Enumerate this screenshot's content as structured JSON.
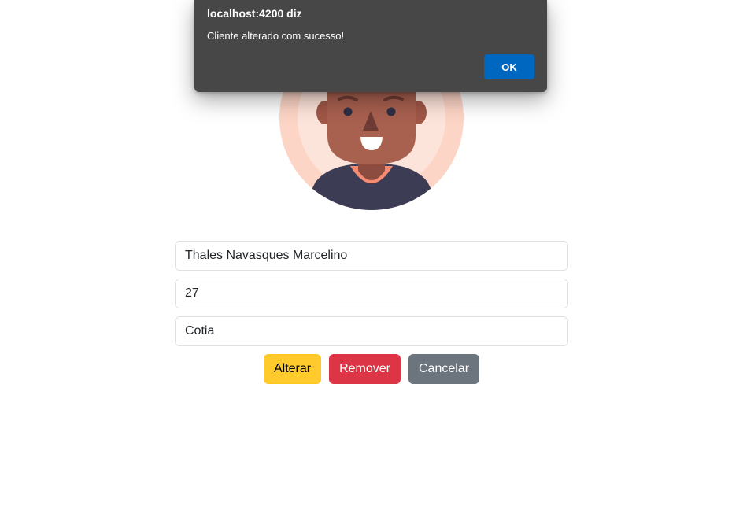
{
  "dialog": {
    "origin": "localhost:4200 diz",
    "message": "Cliente alterado com sucesso!",
    "ok_label": "OK",
    "ok_color": "#0067c0",
    "background": "#474747"
  },
  "avatar": {
    "icon": "person-avatar-illustration",
    "ring_outer_color": "#fdd5c6",
    "ring_inner_color": "#fde4da",
    "skin_color": "#a8604f",
    "shirt_color": "#3c3c55",
    "collar_color": "#f58b73"
  },
  "form": {
    "name": {
      "value": "Thales Navasques Marcelino",
      "placeholder": ""
    },
    "age": {
      "value": "27",
      "placeholder": ""
    },
    "city": {
      "value": "Cotia",
      "placeholder": ""
    }
  },
  "actions": {
    "update_label": "Alterar",
    "remove_label": "Remover",
    "cancel_label": "Cancelar",
    "update_color": "#ffca2c",
    "remove_color": "#dc3545",
    "cancel_color": "#6c757d"
  }
}
